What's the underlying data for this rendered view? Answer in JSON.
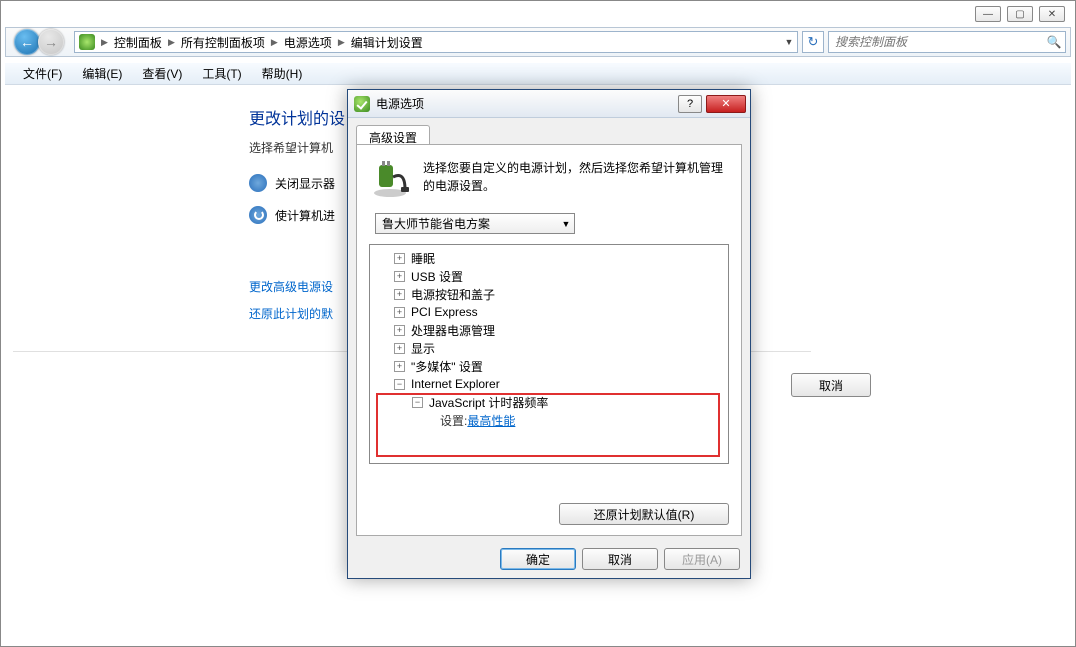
{
  "titlebar": {
    "min": "—",
    "max": "▢",
    "close": "✕"
  },
  "nav": {
    "back": "←",
    "fwd": "→",
    "refresh": "↻",
    "search_placeholder": "搜索控制面板",
    "crumbs": [
      "控制面板",
      "所有控制面板项",
      "电源选项",
      "编辑计划设置"
    ]
  },
  "menus": [
    "文件(F)",
    "编辑(E)",
    "查看(V)",
    "工具(T)",
    "帮助(H)"
  ],
  "page": {
    "heading": "更改计划的设",
    "subtext": "选择希望计算机",
    "opt_display": "关闭显示器",
    "opt_sleep": "使计算机进",
    "link_adv": "更改高级电源设",
    "link_restore": "还原此计划的默",
    "cancel": "取消"
  },
  "dialog": {
    "title": "电源选项",
    "help": "?",
    "close": "✕",
    "tab": "高级设置",
    "info": "选择您要自定义的电源计划，然后选择您希望计算机管理的电源设置。",
    "plan": "鲁大师节能省电方案",
    "tree": {
      "n0": "睡眠",
      "n1": "USB 设置",
      "n2": "电源按钮和盖子",
      "n3": "PCI Express",
      "n4": "处理器电源管理",
      "n5": "显示",
      "n6": "\"多媒体\" 设置",
      "n7": "Internet Explorer",
      "n7c": "JavaScript 计时器频率",
      "n7c_set_label": "设置: ",
      "n7c_set_value": "最高性能"
    },
    "restore": "还原计划默认值(R)",
    "ok": "确定",
    "cancel": "取消",
    "apply": "应用(A)"
  }
}
